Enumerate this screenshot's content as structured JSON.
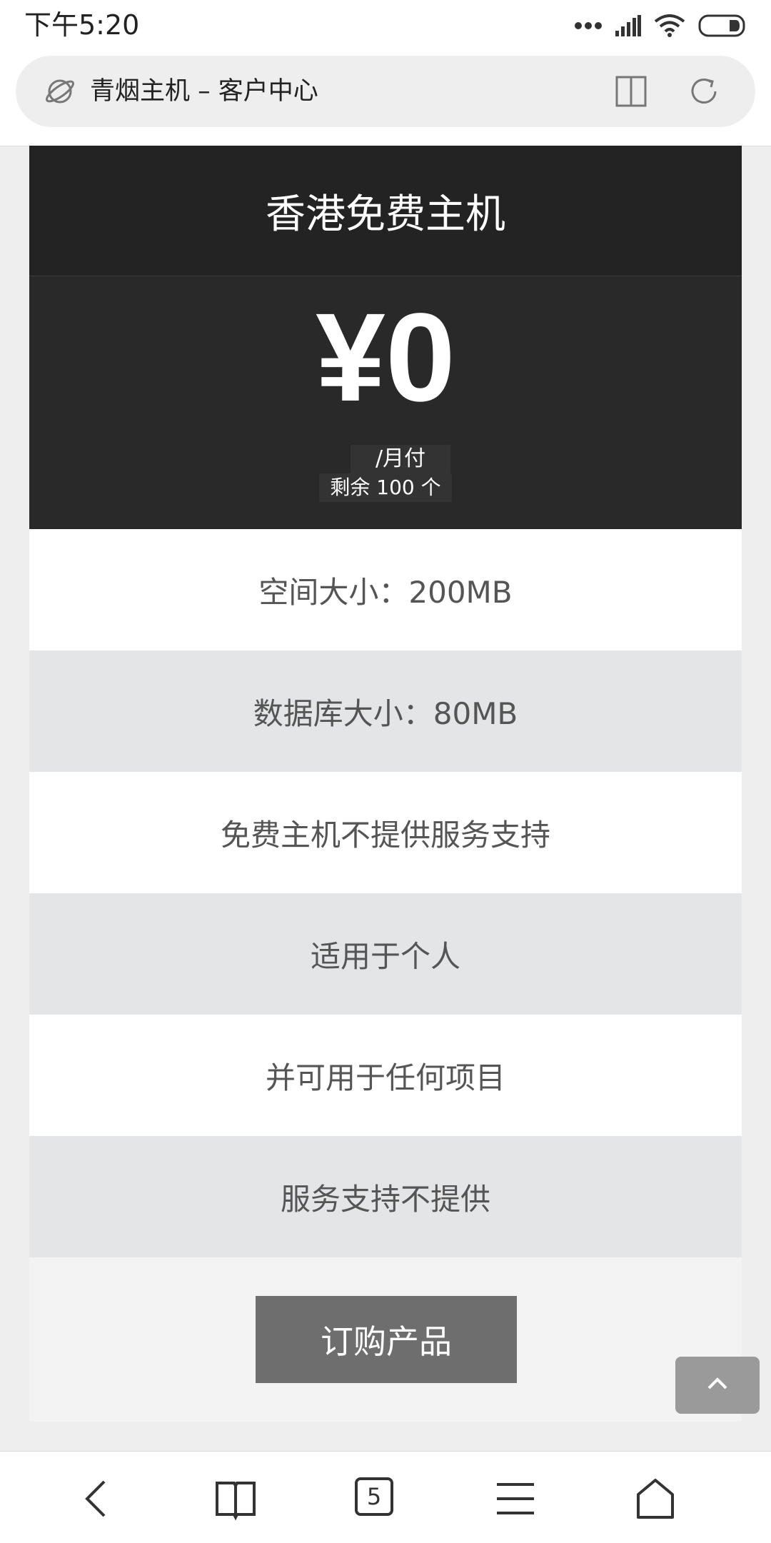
{
  "status_bar": {
    "time": "下午5:20"
  },
  "browser": {
    "page_title": "青烟主机 – 客户中心",
    "tab_count": "5"
  },
  "plan": {
    "name": "香港免费主机",
    "price": "¥0",
    "period": "/月付",
    "remaining": "剩余 100 个",
    "features": [
      "空间大小：200MB",
      "数据库大小：80MB",
      "免费主机不提供服务支持",
      "适用于个人",
      "并可用于任何项目",
      "服务支持不提供"
    ],
    "order_label": "订购产品"
  },
  "colors": {
    "header_bg": "#232323",
    "price_bg": "#292929",
    "button_bg": "#6e6e6e"
  }
}
